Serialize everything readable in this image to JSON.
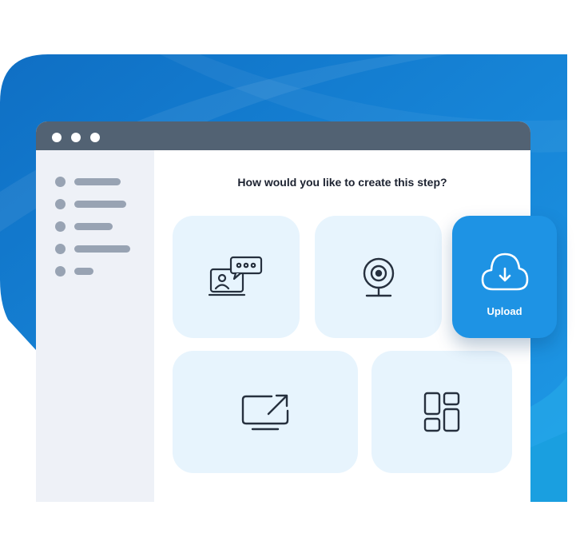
{
  "prompt": {
    "question": "How would you like to create this step?"
  },
  "options": [
    {
      "icon": "video-chat-icon"
    },
    {
      "icon": "webcam-icon"
    },
    {
      "icon": "screen-share-icon"
    },
    {
      "icon": "template-grid-icon"
    }
  ],
  "upload": {
    "label": "Upload",
    "icon": "cloud-download-icon"
  },
  "sidebar": {
    "item_count": 5
  },
  "colors": {
    "accent": "#1e93e4",
    "titlebar": "#526273",
    "tile": "#e7f4fd",
    "sidebar": "#eef1f7",
    "placeholder": "#98a3b3",
    "icon_stroke": "#26303e"
  }
}
